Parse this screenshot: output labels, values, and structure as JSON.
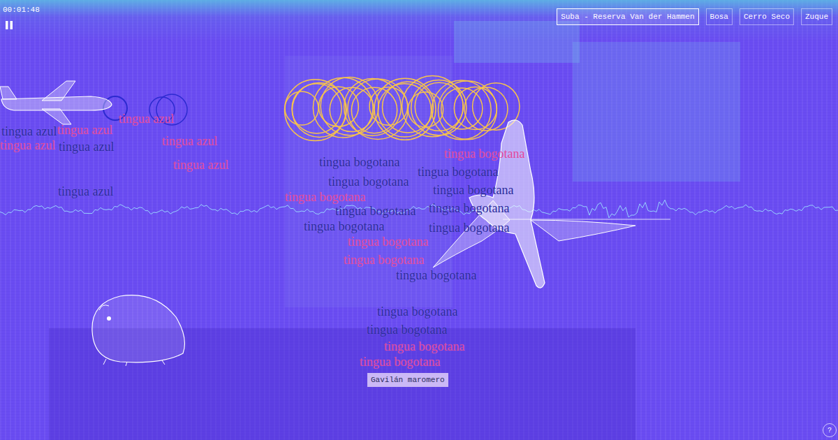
{
  "player": {
    "time": "00:01:48",
    "playing": true
  },
  "locations": [
    {
      "label": "Suba - Reserva Van der Hammen",
      "selected": true
    },
    {
      "label": "Bosa",
      "selected": false
    },
    {
      "label": "Cerro Seco",
      "selected": false
    },
    {
      "label": "Zuque",
      "selected": false
    }
  ],
  "species_labels": [
    {
      "text": "tingua azul",
      "color": "#2b2a9c"
    },
    {
      "text": "tingua azul",
      "color": "#e0449c"
    },
    {
      "text": "tingua azul",
      "color": "#e0449c"
    },
    {
      "text": "tingua azul",
      "color": "#e0449c"
    },
    {
      "text": "tingua azul",
      "color": "#2b2a9c"
    },
    {
      "text": "tingua azul",
      "color": "#e0449c"
    },
    {
      "text": "tingua azul",
      "color": "#e0449c"
    },
    {
      "text": "tingua azul",
      "color": "#2b2a9c"
    },
    {
      "text": "tingua bogotana",
      "color": "#2b2a9c"
    },
    {
      "text": "tingua bogotana",
      "color": "#e0449c"
    },
    {
      "text": "tingua bogotana",
      "color": "#2b2a9c"
    },
    {
      "text": "tingua bogotana",
      "color": "#2b2a9c"
    },
    {
      "text": "tingua bogotana",
      "color": "#e0449c"
    },
    {
      "text": "tingua bogotana",
      "color": "#2b2a9c"
    },
    {
      "text": "tingua bogotana",
      "color": "#2b2a9c"
    },
    {
      "text": "tingua bogotana",
      "color": "#2b2a9c"
    },
    {
      "text": "tingua bogotana",
      "color": "#2b2a9c"
    },
    {
      "text": "tingua bogotana",
      "color": "#2b2a9c"
    },
    {
      "text": "tingua bogotana",
      "color": "#e0449c"
    },
    {
      "text": "tingua bogotana",
      "color": "#e0449c"
    },
    {
      "text": "tingua bogotana",
      "color": "#2b2a9c"
    },
    {
      "text": "tingua bogotana",
      "color": "#2b2a9c"
    },
    {
      "text": "tingua bogotana",
      "color": "#2b2a9c"
    },
    {
      "text": "tingua bogotana",
      "color": "#e0449c"
    },
    {
      "text": "tingua bogotana",
      "color": "#e0449c"
    }
  ],
  "tooltip": {
    "label": "Gavilán maromero"
  },
  "help": {
    "label": "?"
  }
}
